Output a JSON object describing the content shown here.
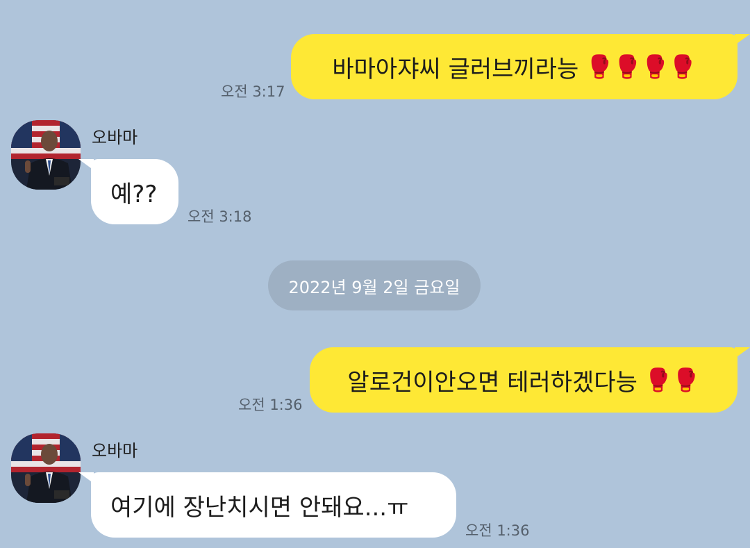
{
  "messages": [
    {
      "text": "바마아쟈씨 글러브끼라능",
      "emoji": "🥊🥊🥊🥊",
      "time": "오전 3:17"
    },
    {
      "sender": "오바마",
      "text": "예??",
      "time": "오전 3:18"
    },
    {
      "text": "알로건이안오면 테러하겠다능",
      "emoji": "🥊🥊",
      "time": "오전 1:36"
    },
    {
      "sender": "오바마",
      "text": "여기에 장난치시면 안돼요...ㅠ",
      "time": "오전 1:36"
    }
  ],
  "date_divider": "2022년 9월 2일 금요일",
  "colors": {
    "background": "#afc4da",
    "my_bubble": "#fee835",
    "their_bubble": "#ffffff",
    "date_pill": "#9eb0c3"
  }
}
